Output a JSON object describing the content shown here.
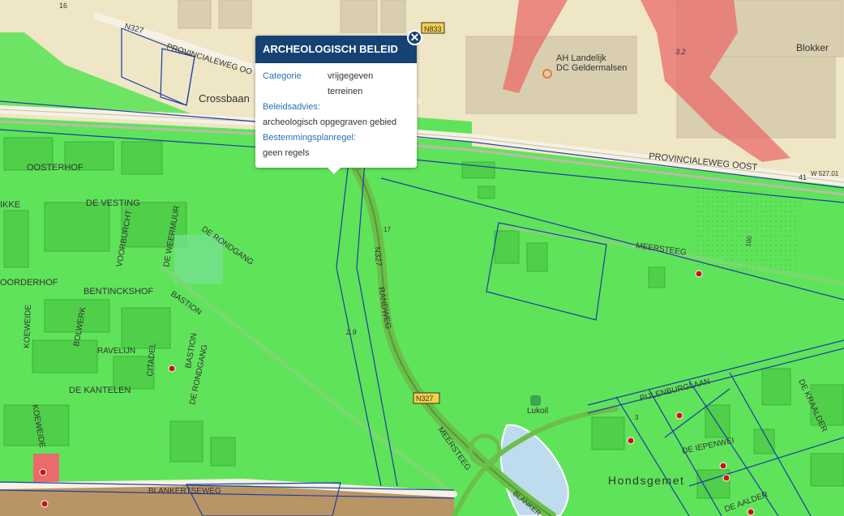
{
  "popup": {
    "title": "ARCHEOLOGISCH BELEID",
    "close_symbol": "✕",
    "categorie_label": "Categorie",
    "categorie_value_line1": "vrijgegeven",
    "categorie_value_line2": "terreinen",
    "beleidsadvies_label": "Beleidsadvies:",
    "beleidsadvies_value": "archeologisch opgegraven gebied",
    "bestemmingsplanregel_label": "Bestemmingsplanregel:",
    "bestemmingsplanregel_value": "geen regels"
  },
  "map": {
    "labels": {
      "n327_top": "N327",
      "n833": "N833",
      "provincialeweg_west": "PROVINCIALEWEG OO",
      "crossbaan": "Crossbaan",
      "ah_dc_line1": "AH Landelijk",
      "ah_dc_line2": "DC Geldermalsen",
      "blokker": "Blokker",
      "elev_32": "3.2",
      "provincialeweg_oost": "PROVINCIALEWEG OOST",
      "num_41": "41",
      "code_w52701": "W 527.01",
      "num_16": "16",
      "oosterhof": "OOSTERHOF",
      "de_vesting": "DE VESTING",
      "ikke": "IKKE",
      "voorburcht": "VOORBURCHT",
      "de_weermuur": "DE WEERMUUR",
      "de_rondgang_n": "DE RONDGANG",
      "oorderhof": "OORDERHOF",
      "bentinckshof": "BENTINCKSHOF",
      "bastion_n": "BASTION",
      "n327_mid": "N327",
      "randweg": "RANDWEG",
      "meersteeg_e": "MEERSTEEG",
      "koeweide_n": "KOEWEIDE",
      "bolwerk": "BOLWERK",
      "ravelijn": "RAVELIJN",
      "citadel": "CITADEL",
      "bastion_s": "BASTION",
      "de_rondgang_s": "DE RONDGANG",
      "elev_29": "2.9",
      "de_kantelen": "DE KANTELEN",
      "n327_low": "N327",
      "lukoil": "Lukoil",
      "pijlenburglaan": "PIJLENBURGLAAN",
      "de_kraalder": "DE KRAALDER",
      "koeweide_s": "KOEWEIDE",
      "meersteeg_s": "MEERSTEEG",
      "de_iepenwei": "DE IEPENWEI",
      "hondsgemet": "Hondsgemet",
      "blankertseweg": "BLANKERTSEWEG",
      "blanker": "BLANKER",
      "de_aalder": "DE AALDER",
      "num_17": "17",
      "num_3": "3",
      "num_100": "100"
    },
    "colors": {
      "base": "#eee6c4",
      "green_zone": "#5fe35a",
      "red_zone": "#e96b6b",
      "boundary": "#1f3ca6",
      "road": "#f5f1e4",
      "water": "#bfdcef"
    }
  }
}
